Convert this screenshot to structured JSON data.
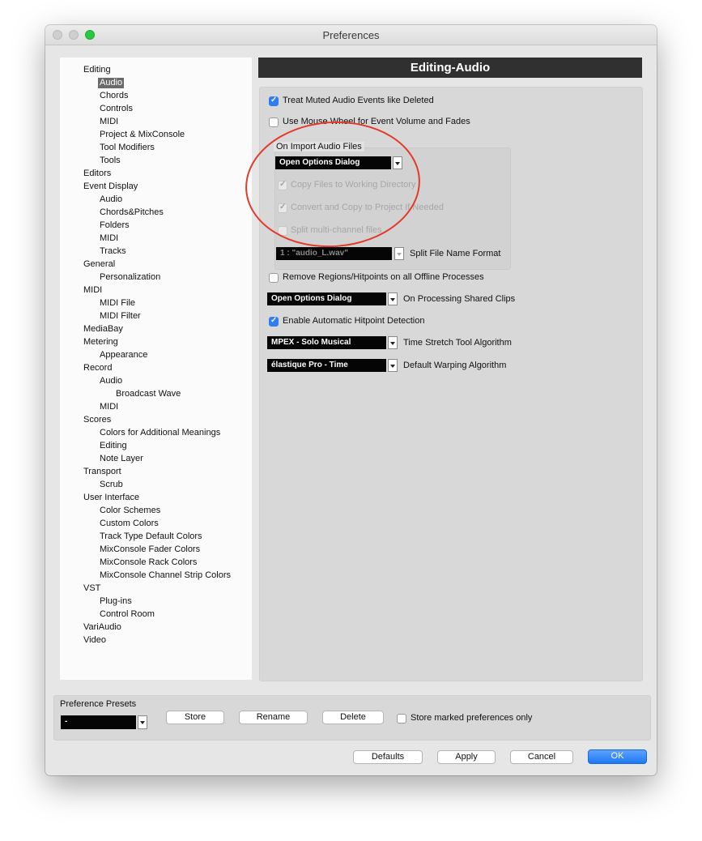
{
  "window": {
    "title": "Preferences"
  },
  "tree": {
    "items": [
      {
        "label": "Editing",
        "level": 0
      },
      {
        "label": "Audio",
        "level": 1,
        "selected": true
      },
      {
        "label": "Chords",
        "level": 1
      },
      {
        "label": "Controls",
        "level": 1
      },
      {
        "label": "MIDI",
        "level": 1
      },
      {
        "label": "Project & MixConsole",
        "level": 1
      },
      {
        "label": "Tool Modifiers",
        "level": 1
      },
      {
        "label": "Tools",
        "level": 1
      },
      {
        "label": "Editors",
        "level": 0
      },
      {
        "label": "Event Display",
        "level": 0
      },
      {
        "label": "Audio",
        "level": 1
      },
      {
        "label": "Chords&Pitches",
        "level": 1
      },
      {
        "label": "Folders",
        "level": 1
      },
      {
        "label": "MIDI",
        "level": 1
      },
      {
        "label": "Tracks",
        "level": 1
      },
      {
        "label": "General",
        "level": 0
      },
      {
        "label": "Personalization",
        "level": 1
      },
      {
        "label": "MIDI",
        "level": 0
      },
      {
        "label": "MIDI File",
        "level": 1
      },
      {
        "label": "MIDI Filter",
        "level": 1
      },
      {
        "label": "MediaBay",
        "level": 0
      },
      {
        "label": "Metering",
        "level": 0
      },
      {
        "label": "Appearance",
        "level": 1
      },
      {
        "label": "Record",
        "level": 0
      },
      {
        "label": "Audio",
        "level": 1
      },
      {
        "label": "Broadcast Wave",
        "level": 2
      },
      {
        "label": "MIDI",
        "level": 1
      },
      {
        "label": "Scores",
        "level": 0
      },
      {
        "label": "Colors for Additional Meanings",
        "level": 1
      },
      {
        "label": "Editing",
        "level": 1
      },
      {
        "label": "Note Layer",
        "level": 1
      },
      {
        "label": "Transport",
        "level": 0
      },
      {
        "label": "Scrub",
        "level": 1
      },
      {
        "label": "User Interface",
        "level": 0
      },
      {
        "label": "Color Schemes",
        "level": 1
      },
      {
        "label": "Custom Colors",
        "level": 1
      },
      {
        "label": "Track Type Default Colors",
        "level": 1
      },
      {
        "label": "MixConsole Fader Colors",
        "level": 1
      },
      {
        "label": "MixConsole Rack Colors",
        "level": 1
      },
      {
        "label": "MixConsole Channel Strip Colors",
        "level": 1
      },
      {
        "label": "VST",
        "level": 0
      },
      {
        "label": "Plug-ins",
        "level": 1
      },
      {
        "label": "Control Room",
        "level": 1
      },
      {
        "label": "VariAudio",
        "level": 0
      },
      {
        "label": "Video",
        "level": 0
      }
    ]
  },
  "panel": {
    "header": "Editing-Audio",
    "treat_muted": {
      "label": "Treat Muted Audio Events like Deleted",
      "checked": true
    },
    "mouse_wheel": {
      "label": "Use Mouse Wheel for Event Volume and Fades",
      "checked": false
    },
    "import_group": {
      "title": "On Import Audio Files",
      "mode": "Open Options Dialog",
      "copy_files": {
        "label": "Copy Files to Working Directory",
        "checked": true
      },
      "convert_copy": {
        "label": "Convert and Copy to Project If Needed",
        "checked": true
      },
      "split_multi": {
        "label": "Split multi-channel files",
        "checked": false
      },
      "split_format_value": "1 : \"audio_L.wav\"",
      "split_format_label": "Split File Name Format"
    },
    "remove_regions": {
      "label": "Remove Regions/Hitpoints on all Offline Processes",
      "checked": false
    },
    "shared_clips": {
      "value": "Open Options Dialog",
      "label": "On Processing Shared Clips"
    },
    "auto_hitpoint": {
      "label": "Enable Automatic Hitpoint Detection",
      "checked": true
    },
    "time_stretch": {
      "value": "MPEX - Solo Musical",
      "label": "Time Stretch Tool Algorithm"
    },
    "warping": {
      "value": "élastique Pro - Time",
      "label": "Default Warping Algorithm"
    }
  },
  "presets": {
    "title": "Preference Presets",
    "selected": "-",
    "store": "Store",
    "rename": "Rename",
    "delete": "Delete",
    "marked_only": {
      "label": "Store marked preferences only",
      "checked": false
    }
  },
  "footer": {
    "defaults": "Defaults",
    "apply": "Apply",
    "cancel": "Cancel",
    "ok": "OK"
  },
  "colors": {
    "accent": "#2f7cf6",
    "annotation": "#e33a2a",
    "header_bg": "#303030"
  }
}
